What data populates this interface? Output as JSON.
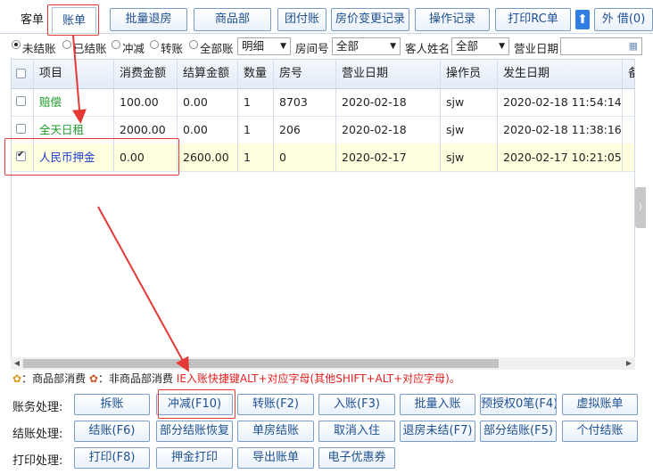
{
  "top_tabs": [
    "客单",
    "账单"
  ],
  "toolbar": [
    "批量退房",
    "商品部",
    "团付账",
    "房价变更记录",
    "操作记录",
    "打印RC单",
    "外 借(0)"
  ],
  "filter": {
    "radios": [
      "未结账",
      "已结账",
      "冲减",
      "转账",
      "全部账"
    ],
    "selected_radio": "未结账",
    "view_select": "明细",
    "room_label": "房间号",
    "room_select": "全部",
    "guest_label": "客人姓名",
    "guest_select": "全部",
    "biz_date_label": "营业日期"
  },
  "grid": {
    "headers": [
      "项目",
      "消费金额",
      "结算金额",
      "数量",
      "房号",
      "营业日期",
      "操作员",
      "发生日期",
      "备"
    ],
    "rows": [
      {
        "checked": false,
        "item": "赔偿",
        "consume": "100.00",
        "settle": "0.00",
        "qty": "1",
        "room": "8703",
        "biz_date": "2020-02-18",
        "operator": "sjw",
        "occur": "2020-02-18 11:54:14"
      },
      {
        "checked": false,
        "item": "全天日租",
        "consume": "2000.00",
        "settle": "0.00",
        "qty": "1",
        "room": "206",
        "biz_date": "2020-02-18",
        "operator": "sjw",
        "occur": "2020-02-18 11:38:16"
      },
      {
        "checked": true,
        "item": "人民币押金",
        "consume": "0.00",
        "settle": "2600.00",
        "qty": "1",
        "room": "0",
        "biz_date": "2020-02-17",
        "operator": "sjw",
        "occur": "2020-02-17 10:21:05"
      }
    ]
  },
  "legend": {
    "goods": "：商品部消费",
    "non_goods": "：非商品部消费",
    "tip": "IE入账快捷键ALT+对应字母(其他SHIFT+ALT+对应字母)。"
  },
  "actions": {
    "business": {
      "label": "账务处理:",
      "buttons": [
        "拆账",
        "冲减(F10)",
        "转账(F2)",
        "入账(F3)",
        "批量入账",
        "预授权0笔(F4)",
        "虚拟账单"
      ]
    },
    "checkout": {
      "label": "结账处理:",
      "buttons": [
        "结账(F6)",
        "部分结账恢复",
        "单房结账",
        "取消入住",
        "退房未结(F7)",
        "部分结账(F5)",
        "个付结账"
      ]
    },
    "print": {
      "label": "打印处理:",
      "buttons": [
        "打印(F8)",
        "押金打印",
        "导出账单",
        "电子优惠券"
      ]
    }
  },
  "colors": {
    "accent": "#1d4f91",
    "selected_row": "#ffffe0",
    "annotation": "#e53935",
    "item_green": "#1a9a2a",
    "item_blue": "#1d3bd0"
  }
}
